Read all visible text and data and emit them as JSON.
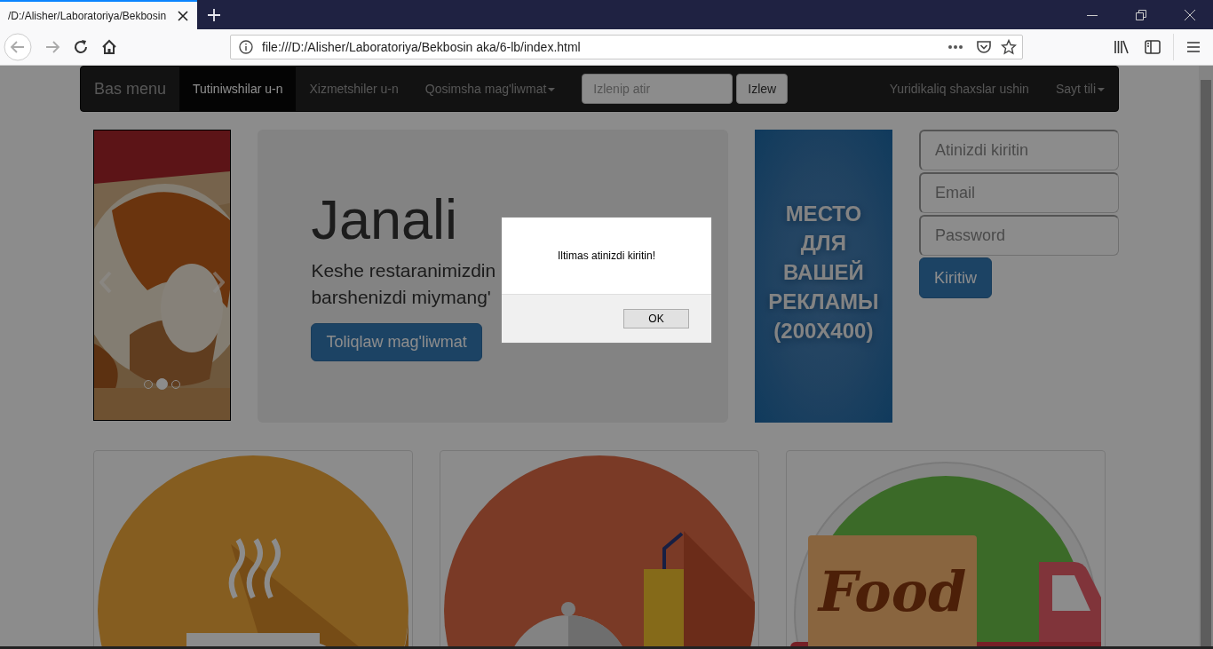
{
  "browser": {
    "tab": {
      "title": "/D:/Alisher/Laboratoriya/Bekbosin"
    },
    "url": "file:///D:/Alisher/Laboratoriya/Bekbosin aka/6-lb/index.html"
  },
  "navbar": {
    "brand": "Bas menu",
    "items": [
      {
        "label": "Tutiniwshilar u-n",
        "selected": true,
        "dropdown": false
      },
      {
        "label": "Xizmetshiler u-n",
        "selected": false,
        "dropdown": false
      },
      {
        "label": "Qosimsha mag'liwmat",
        "selected": false,
        "dropdown": true
      }
    ],
    "search": {
      "placeholder": "Izlenip atir"
    },
    "search_button": "Izlew",
    "right_items": [
      {
        "label": "Yuridikaliq shaxslar ushin",
        "dropdown": false
      },
      {
        "label": "Sayt tili",
        "dropdown": true
      }
    ]
  },
  "carousel": {
    "kind": "picture",
    "indicators": [
      {
        "selected": false
      },
      {
        "selected": true
      },
      {
        "selected": false
      }
    ]
  },
  "jumbotron": {
    "heading": "Janali",
    "lines": [
      "Keshe restaranimizdin",
      "barshenizdi miymang'"
    ],
    "button": "Toliqlaw mag'liwmat"
  },
  "ad_banner": {
    "lines": [
      "МЕСТО",
      "ДЛЯ",
      "ВАШЕЙ",
      "РЕКЛАМЫ",
      "(200X400)"
    ]
  },
  "login_form": {
    "fields": [
      {
        "placeholder": "Atinizdi kiritin"
      },
      {
        "placeholder": "Email"
      },
      {
        "placeholder": "Password"
      }
    ],
    "button": "Kiritiw"
  },
  "cards": [
    {
      "kind": "cup"
    },
    {
      "kind": "cloche"
    },
    {
      "kind": "truck",
      "label": "Food"
    }
  ],
  "dialog": {
    "message": "Iltimas atinizdi kiritin!",
    "button": "OK"
  }
}
